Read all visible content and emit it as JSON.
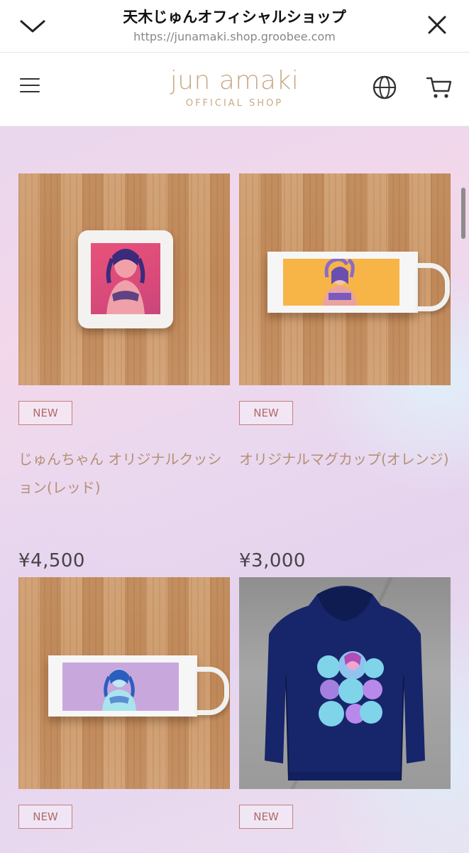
{
  "browser": {
    "title": "天木じゅんオフィシャルショップ",
    "url": "https://junamaki.shop.groobee.com",
    "icons": {
      "collapse": "chevron-down-icon",
      "close": "close-icon"
    }
  },
  "header": {
    "logo_main": "jun amaki",
    "logo_sub": "OFFICIAL SHOP",
    "icons": {
      "menu": "hamburger-menu-icon",
      "language": "globe-icon",
      "cart": "cart-icon"
    },
    "logo_color": "#c9a987"
  },
  "products": [
    {
      "badge": "NEW",
      "name": "じゅんちゃん オリジナルクッション(レッド)",
      "price": "¥4,500",
      "image": "cushion-red"
    },
    {
      "badge": "NEW",
      "name": "オリジナルマグカップ(オレンジ)",
      "price": "¥3,000",
      "image": "mug-orange"
    },
    {
      "badge": "NEW",
      "name": "",
      "price": "",
      "image": "mug-purple"
    },
    {
      "badge": "NEW",
      "name": "",
      "price": "",
      "image": "hoodie-navy"
    }
  ]
}
